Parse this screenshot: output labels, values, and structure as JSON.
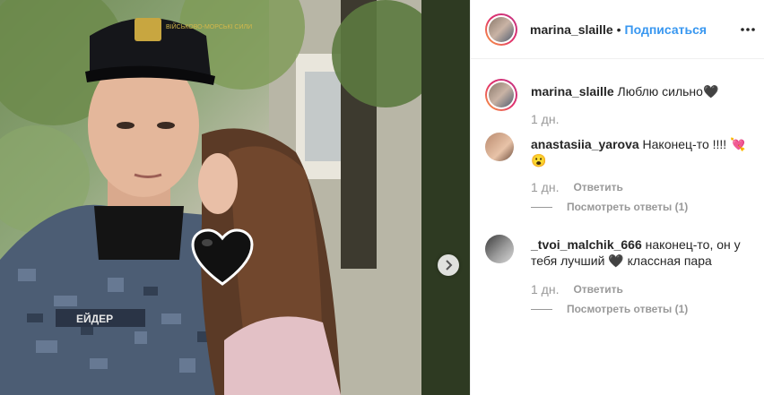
{
  "post": {
    "username": "marina_slaille",
    "separator": "•",
    "follow_label": "Подписаться"
  },
  "caption": {
    "username": "marina_slaille",
    "text": "Люблю сильно🖤",
    "time": "1 дн."
  },
  "comments": [
    {
      "username": "anastasiia_yarova",
      "text": "Наконец-то !!!! 💘 😮",
      "time": "1 дн.",
      "reply_label": "Ответить",
      "view_replies": "Посмотреть ответы (1)"
    },
    {
      "username": "_tvoi_malchik_666",
      "text": "наконец-то, он у тебя лучший 🖤 классная пара",
      "time": "1 дн.",
      "reply_label": "Ответить",
      "view_replies": "Посмотреть ответы (1)"
    }
  ],
  "photo": {
    "cap_badge_text": "ВІЙСЬКОВО-МОРСЬКІ СИЛИ",
    "name_patch": "ЕЙДЕР",
    "sticker": "black-heart"
  },
  "colors": {
    "link": "#3897f0",
    "muted": "#999999",
    "story_ring_start": "#f9a33e",
    "story_ring_end": "#c13584"
  }
}
